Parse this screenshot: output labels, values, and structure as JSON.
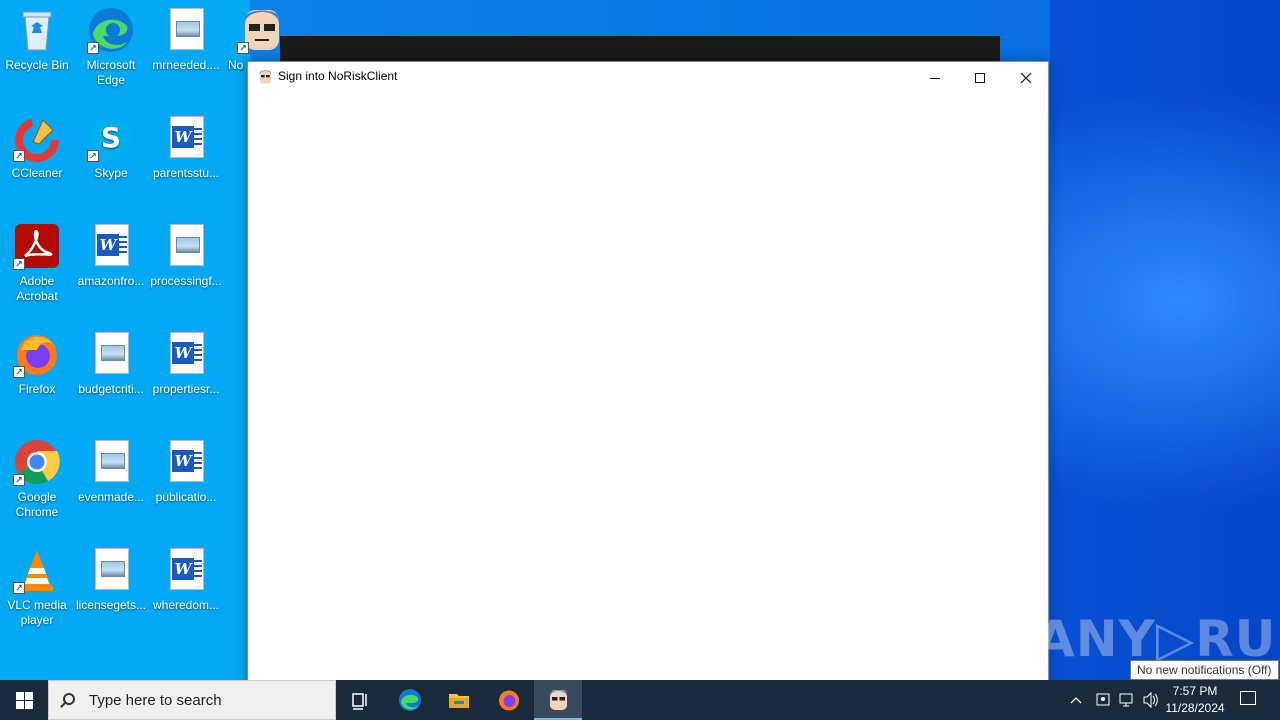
{
  "desktop": {
    "icons": [
      {
        "label": "Recycle Bin",
        "icon": "recycle-bin-icon"
      },
      {
        "label": "Microsoft Edge",
        "icon": "edge-icon"
      },
      {
        "label": "mrneeded....",
        "icon": "image-file-icon"
      },
      {
        "label": "No",
        "icon": "norisk-icon"
      },
      {
        "label": "CCleaner",
        "icon": "ccleaner-icon"
      },
      {
        "label": "Skype",
        "icon": "skype-icon"
      },
      {
        "label": "parentsstu...",
        "icon": "word-file-icon"
      },
      {
        "label": "Adobe Acrobat",
        "icon": "acrobat-icon"
      },
      {
        "label": "amazonfro...",
        "icon": "word-file-icon"
      },
      {
        "label": "processingf...",
        "icon": "image-file-icon"
      },
      {
        "label": "Firefox",
        "icon": "firefox-icon"
      },
      {
        "label": "budgetcriti...",
        "icon": "image-file-icon"
      },
      {
        "label": "propertiesr...",
        "icon": "word-file-icon"
      },
      {
        "label": "Google Chrome",
        "icon": "chrome-icon"
      },
      {
        "label": "evenmade...",
        "icon": "image-file-icon"
      },
      {
        "label": "publicatio...",
        "icon": "word-file-icon"
      },
      {
        "label": "VLC media player",
        "icon": "vlc-icon"
      },
      {
        "label": "licensegets...",
        "icon": "image-file-icon"
      },
      {
        "label": "wheredom...",
        "icon": "word-file-icon"
      }
    ]
  },
  "window": {
    "title": "Sign into NoRiskClient",
    "icon": "norisk-icon",
    "controls": {
      "minimize": "minimize-icon",
      "maximize": "maximize-icon",
      "close": "close-icon"
    }
  },
  "watermark": "ANY▷RUN",
  "tooltip": "No new notifications (Off)",
  "taskbar": {
    "search_placeholder": "Type here to search",
    "apps": [
      "task-view-icon",
      "edge-icon",
      "file-explorer-icon",
      "firefox-icon",
      "norisk-icon"
    ],
    "clock": {
      "time": "7:57 PM",
      "date": "11/28/2024"
    }
  },
  "colors": {
    "desktop_left": "#03a9f4",
    "taskbar": "#1b2a3a",
    "word_blue": "#185abd"
  }
}
